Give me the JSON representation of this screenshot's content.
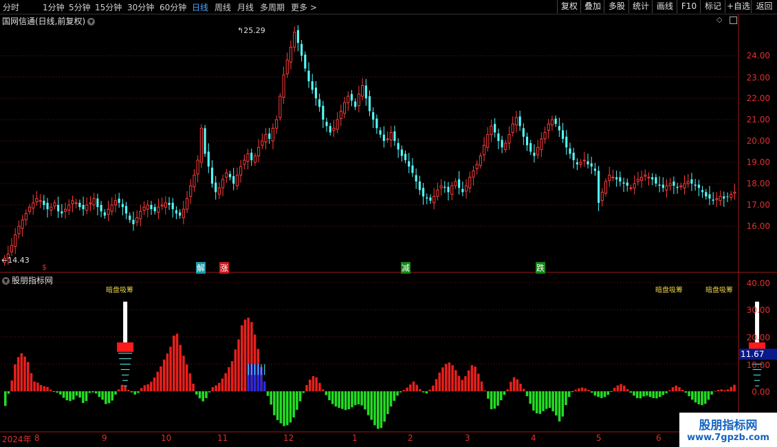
{
  "toolbar": {
    "periods": [
      "分时",
      "1分钟",
      "5分钟",
      "15分钟",
      "30分钟",
      "60分钟",
      "日线",
      "周线",
      "月线",
      "多周期",
      "更多 >"
    ],
    "active_period": "日线",
    "right_buttons": [
      "复权",
      "叠加",
      "多股",
      "统计",
      "画线",
      "F10",
      "标记",
      "+自选",
      "返回"
    ]
  },
  "main_panel": {
    "title": "国网信通(日线,前复权)",
    "high_label": "25.29",
    "low_label": "14.43",
    "signals": [
      {
        "text": "解",
        "bg": "#1a9aa8"
      },
      {
        "text": "涨",
        "bg": "#c81818"
      },
      {
        "text": "减",
        "bg": "#118811"
      },
      {
        "text": "跌",
        "bg": "#118811"
      }
    ],
    "small_marker": "$"
  },
  "indicator_panel": {
    "title": "股朋指标网",
    "alert_label": "暗盘吸筹",
    "current_value": "11.67"
  },
  "chart_data": [
    {
      "type": "candlestick",
      "title": "国网信通(日线,前复权)",
      "y_ticks": [
        "24.00",
        "23.00",
        "22.00",
        "21.00",
        "20.00",
        "19.00",
        "18.00",
        "17.00",
        "16.00"
      ],
      "ylim": [
        14.0,
        25.8
      ],
      "annotations": {
        "high": 25.29,
        "low": 14.43
      },
      "x_ticks": [
        "2024年",
        "8",
        "9",
        "10",
        "11",
        "12",
        "1",
        "2",
        "3",
        "4",
        "5",
        "6"
      ],
      "closes": [
        14.5,
        14.7,
        15.1,
        15.6,
        16.0,
        16.3,
        16.6,
        16.9,
        17.1,
        17.3,
        17.2,
        17.0,
        16.8,
        16.9,
        17.1,
        16.7,
        16.6,
        16.8,
        17.0,
        17.2,
        17.1,
        16.9,
        16.8,
        17.0,
        17.1,
        17.3,
        16.9,
        16.7,
        16.5,
        16.8,
        17.0,
        17.2,
        17.1,
        16.9,
        16.6,
        16.3,
        16.1,
        16.4,
        16.7,
        16.9,
        17.0,
        16.8,
        16.7,
        16.9,
        17.0,
        17.1,
        17.0,
        16.8,
        16.6,
        16.5,
        16.8,
        17.3,
        17.9,
        18.4,
        19.1,
        20.6,
        19.4,
        18.8,
        18.0,
        17.6,
        17.8,
        18.2,
        18.5,
        18.3,
        18.0,
        18.4,
        18.8,
        19.1,
        19.4,
        19.1,
        19.3,
        19.7,
        20.0,
        20.3,
        20.1,
        20.6,
        21.0,
        22.1,
        23.1,
        23.8,
        24.4,
        25.1,
        24.6,
        24.0,
        23.4,
        22.8,
        22.4,
        22.0,
        21.6,
        21.0,
        20.7,
        20.4,
        20.6,
        21.0,
        21.4,
        21.8,
        22.1,
        21.9,
        21.6,
        22.2,
        22.6,
        22.0,
        21.4,
        21.0,
        20.6,
        20.3,
        20.0,
        20.1,
        20.4,
        20.0,
        19.6,
        19.3,
        19.1,
        18.8,
        18.5,
        18.1,
        17.7,
        17.4,
        17.3,
        17.2,
        17.4,
        17.7,
        17.9,
        17.8,
        17.6,
        17.9,
        18.1,
        17.8,
        17.6,
        17.9,
        18.3,
        18.6,
        18.9,
        19.3,
        19.8,
        20.3,
        20.7,
        20.4,
        20.0,
        19.7,
        19.9,
        20.3,
        20.8,
        21.1,
        20.7,
        20.2,
        19.8,
        19.5,
        19.3,
        19.7,
        20.1,
        20.4,
        20.8,
        21.0,
        20.8,
        20.5,
        20.1,
        19.7,
        19.4,
        19.1,
        18.9,
        19.0,
        19.1,
        18.9,
        18.8,
        18.6,
        17.1,
        17.6,
        18.1,
        18.4,
        18.3,
        18.2,
        18.1,
        18.0,
        17.9,
        17.8,
        18.0,
        18.2,
        18.3,
        18.4,
        18.3,
        18.2,
        18.0,
        17.9,
        17.8,
        17.9,
        18.0,
        17.9,
        17.8,
        17.9,
        18.0,
        18.1,
        18.0,
        17.9,
        17.8,
        17.6,
        17.4,
        17.3,
        17.2,
        17.3,
        17.4,
        17.3,
        17.4,
        17.5,
        17.6
      ]
    },
    {
      "type": "bar",
      "title": "股朋指标网",
      "y_ticks": [
        "40.00",
        "30.00",
        "20.00",
        "10.00",
        "0.00"
      ],
      "ylim": [
        -14,
        42
      ],
      "current": 11.67,
      "values": [
        -5.4,
        -0.9,
        4,
        9.9,
        12.6,
        14,
        12.8,
        10.8,
        6.7,
        3.6,
        3.2,
        2.3,
        1.9,
        1.6,
        0.6,
        -0.1,
        -0.5,
        -1.2,
        -2.4,
        -3.3,
        -3.6,
        -3.1,
        -1.6,
        -2.3,
        -4.3,
        -3.6,
        -0.6,
        -0.4,
        -0.8,
        -2.1,
        -3.1,
        -4.7,
        -4.4,
        -3.4,
        -1.2,
        0.7,
        2.4,
        1.8,
        0.5,
        -0.4,
        -1.2,
        -0.6,
        1.2,
        2.2,
        2.6,
        3.5,
        5.1,
        7.2,
        9.2,
        11.7,
        13.9,
        16.4,
        20.5,
        21.2,
        17.1,
        13.1,
        9.9,
        6.6,
        2.8,
        -1.2,
        -2.6,
        -3.7,
        -2.5,
        -0.4,
        1.5,
        2.2,
        3.1,
        4.7,
        6.7,
        8.9,
        11.1,
        15.4,
        19.1,
        24.3,
        26.4,
        27.1,
        25.5,
        20.9,
        15.6,
        8.9,
        3.6,
        -1.7,
        -4.9,
        -8.8,
        -10.6,
        -11.8,
        -12.8,
        -12.5,
        -11.5,
        -9.6,
        -6.8,
        -3.7,
        -0.6,
        2.3,
        4.3,
        5.6,
        5.1,
        3.1,
        0.7,
        -1.4,
        -3.3,
        -4.7,
        -5.6,
        -6.1,
        -6.5,
        -6.9,
        -6.6,
        -5.9,
        -5.1,
        -4.8,
        -5.2,
        -6.7,
        -8.8,
        -10.5,
        -12.5,
        -13.8,
        -13.5,
        -11.2,
        -8.4,
        -5.6,
        -3.5,
        -1.6,
        -0.4,
        0.5,
        1.4,
        2.5,
        3.6,
        2.4,
        0.8,
        -0.4,
        -0.8,
        0.6,
        2.1,
        4.5,
        6.9,
        8.8,
        10.1,
        10.6,
        9.6,
        7.8,
        5.7,
        4.2,
        5.6,
        7.7,
        9.6,
        9.1,
        6.5,
        3.6,
        0.3,
        -2.7,
        -6.6,
        -6.4,
        -5.3,
        -3.3,
        -1.3,
        0.7,
        3.5,
        5.2,
        4.4,
        2.8,
        0.9,
        -1.8,
        -4.6,
        -7.1,
        -8.1,
        -8.3,
        -7.3,
        -6.5,
        -6.1,
        -7.4,
        -8.9,
        -11.1,
        -9.3,
        -5.1,
        -2.1,
        -0.3,
        0.6,
        1.1,
        1.4,
        1.1,
        0.5,
        -0.5,
        -1.6,
        -2.1,
        -2.5,
        -2.1,
        -1.3,
        -0.1,
        1.3,
        2.2,
        2.7,
        2.1,
        0.8,
        -0.5,
        -1.6,
        -2.5,
        -2.6,
        -1.9,
        -1.6,
        -2.1,
        -2.5,
        -2.6,
        -2.1,
        -1.4,
        -0.7,
        0.4,
        1.5,
        2.1,
        1.5,
        0.5,
        -0.5,
        -1.8,
        -3.1,
        -4.1,
        -4.8,
        -5.1,
        -4.6,
        -3.1,
        -1.2,
        0.1,
        0.5,
        0.7,
        0.4,
        0.7,
        1.6,
        2.4
      ],
      "blue_signal_range": [
        75,
        86
      ],
      "alert_positions": [
        37,
        232,
        250
      ]
    }
  ],
  "watermark": {
    "line1": "股朋指标网",
    "line2": "www.7gpzb.com"
  }
}
